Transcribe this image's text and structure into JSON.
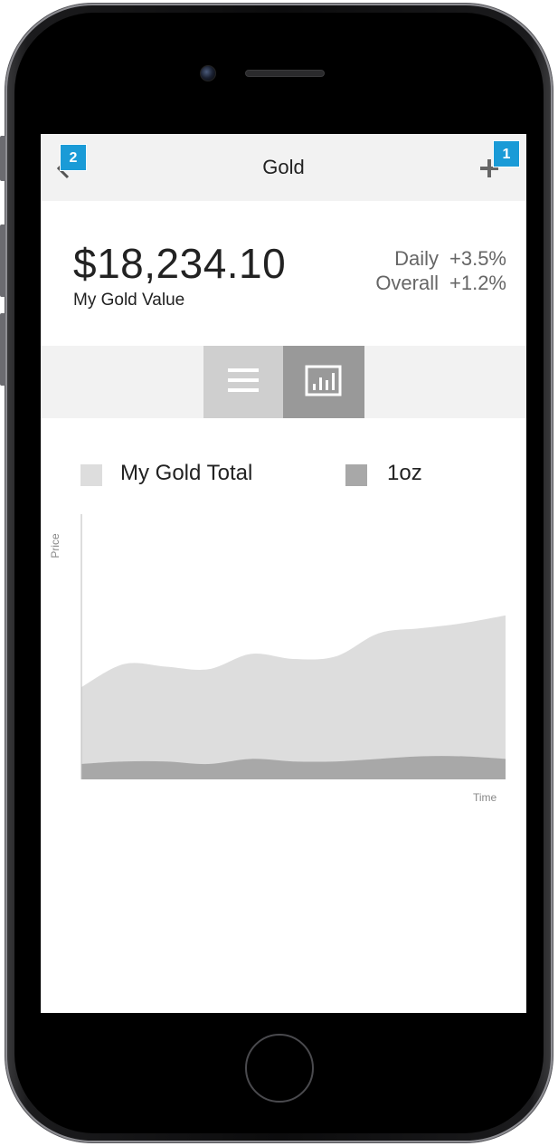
{
  "app": {
    "nav_title": "Gold",
    "badges": {
      "plus_badge": "1",
      "back_badge": "2"
    }
  },
  "summary": {
    "value": "$18,234.10",
    "value_label": "My Gold Value",
    "stats": [
      {
        "label": "Daily",
        "value": "+3.5%"
      },
      {
        "label": "Overall",
        "value": "+1.2%"
      }
    ]
  },
  "view_toggle": {
    "options": [
      "list-view",
      "chart-view"
    ],
    "selected": "chart-view"
  },
  "chart_data": {
    "type": "area",
    "xlabel": "Time",
    "ylabel": "Price",
    "legend": [
      {
        "name": "My Gold Total",
        "color": "#dddddd"
      },
      {
        "name": "1oz",
        "color": "#a8a8a8"
      }
    ],
    "x": [
      0,
      1,
      2,
      3,
      4,
      5,
      6,
      7,
      8,
      9,
      10
    ],
    "ylim": [
      0,
      100
    ],
    "series": [
      {
        "name": "My Gold Total",
        "color": "#dddddd",
        "values": [
          36,
          45,
          44,
          43,
          49,
          47,
          48,
          57,
          59,
          61,
          64
        ]
      },
      {
        "name": "1oz",
        "color": "#a8a8a8",
        "values": [
          6,
          7,
          7,
          6,
          8,
          7,
          7,
          8,
          9,
          9,
          8
        ]
      }
    ]
  },
  "colors": {
    "accent_badge": "#1a9bd7",
    "navbar_bg": "#f2f2f2"
  }
}
